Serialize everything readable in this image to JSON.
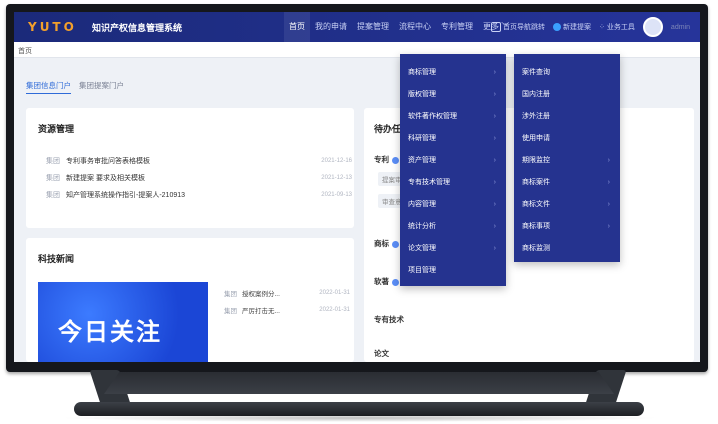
{
  "navbar": {
    "logo": "YUTO",
    "system_title": "知识产权信息管理系统",
    "items": [
      {
        "label": "首页",
        "active": true
      },
      {
        "label": "我的申请",
        "active": false
      },
      {
        "label": "提案管理",
        "active": false
      },
      {
        "label": "流程中心",
        "active": false
      },
      {
        "label": "专利管理",
        "active": false
      },
      {
        "label": "更多",
        "active": false
      }
    ],
    "right": {
      "shortcut": "首页导航跳转",
      "new_label": "新建提案",
      "workbench": "业务工具",
      "username": "admin"
    }
  },
  "breadcrumb": "首页",
  "tabs": [
    {
      "label": "集团信息门户",
      "active": true
    },
    {
      "label": "集团提案门户",
      "active": false
    }
  ],
  "resource": {
    "title": "资源管理",
    "rows": [
      {
        "tag": "集团",
        "text": "专利事务审批问答表格模板",
        "date": "2021-12-16"
      },
      {
        "tag": "集团",
        "text": "新建提案 要求及相关模板",
        "date": "2021-12-13"
      },
      {
        "tag": "集团",
        "text": "知产管理系统操作指引-提案人-210913",
        "date": "2021-09-13"
      }
    ]
  },
  "news": {
    "title": "科技新闻",
    "banner_text": "今日关注",
    "arrow": "›",
    "rows": [
      {
        "tag": "集团",
        "text": "授权案例分...",
        "date": "2022-01-31"
      },
      {
        "tag": "集团",
        "text": "严厉打击无...",
        "date": "2022-01-31"
      }
    ]
  },
  "todo": {
    "title": "待办任务",
    "sections": [
      "专利",
      "商标",
      "软著",
      "专有技术",
      "论文"
    ],
    "sub_labels": [
      "提案审批",
      "审查意见"
    ]
  },
  "more_menu": {
    "column1": [
      {
        "label": "商标管理",
        "has_sub": true
      },
      {
        "label": "版权管理",
        "has_sub": true
      },
      {
        "label": "软件著作权管理",
        "has_sub": true
      },
      {
        "label": "科研管理",
        "has_sub": true
      },
      {
        "label": "资产管理",
        "has_sub": true
      },
      {
        "label": "专有技术管理",
        "has_sub": true
      },
      {
        "label": "内容管理",
        "has_sub": true
      },
      {
        "label": "统计分析",
        "has_sub": true
      },
      {
        "label": "论文管理",
        "has_sub": true
      },
      {
        "label": "项目管理",
        "has_sub": false
      }
    ],
    "column2": [
      {
        "label": "案件查询",
        "has_sub": false
      },
      {
        "label": "国内注册",
        "has_sub": false
      },
      {
        "label": "涉外注册",
        "has_sub": false
      },
      {
        "label": "使用申请",
        "has_sub": false
      },
      {
        "label": "期限监控",
        "has_sub": true
      },
      {
        "label": "商标案件",
        "has_sub": true
      },
      {
        "label": "商标文件",
        "has_sub": true
      },
      {
        "label": "商标事项",
        "has_sub": true
      },
      {
        "label": "商标监测",
        "has_sub": false
      }
    ]
  },
  "colors": {
    "navbar": "#1b2a7a",
    "menu_bg": "#25338f",
    "accent": "#2f6bd8",
    "logo": "#f3a02b"
  }
}
